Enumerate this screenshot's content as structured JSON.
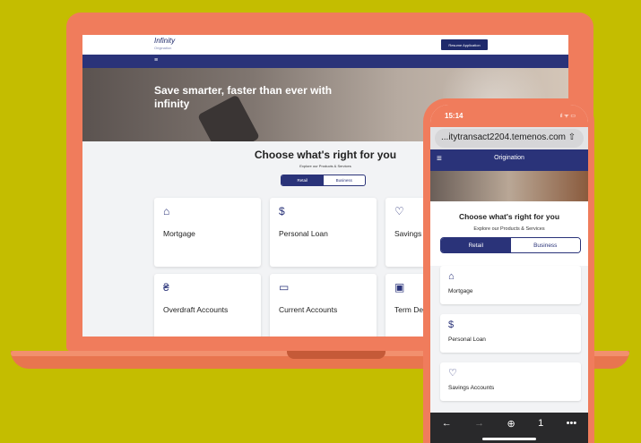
{
  "laptop": {
    "logo": "Infinity",
    "logo_sub": "Origination",
    "resume_button": "Resume Application",
    "menu_icon": "≡",
    "hero_text": "Save smarter, faster than ever with infinity",
    "heading": "Choose what's right for you",
    "subheading": "Explore our Products & Services",
    "tabs": [
      "Retail",
      "Business"
    ],
    "cards": [
      {
        "label": "Mortgage",
        "icon": "house-icon",
        "glyph": "⌂"
      },
      {
        "label": "Personal Loan",
        "icon": "hand-dollar-icon",
        "glyph": "$"
      },
      {
        "label": "Savings",
        "icon": "piggy-bank-icon",
        "glyph": "♡"
      },
      {
        "label": "Overdraft Accounts",
        "icon": "money-bag-icon",
        "glyph": "₴"
      },
      {
        "label": "Current Accounts",
        "icon": "banknote-icon",
        "glyph": "▭"
      },
      {
        "label": "Term De",
        "icon": "safe-icon",
        "glyph": "▣"
      }
    ]
  },
  "phone": {
    "time": "15:14",
    "status_icons": "ıl ᯤ ▭",
    "url": "...itytransact2204.temenos.com ⇧",
    "menu_icon": "≡",
    "title": "Origination",
    "heading": "Choose what's right for you",
    "subheading": "Explore our Products & Services",
    "tabs": [
      "Retail",
      "Business"
    ],
    "cards": [
      {
        "label": "Mortgage",
        "icon": "house-icon",
        "glyph": "⌂"
      },
      {
        "label": "Personal Loan",
        "icon": "hand-dollar-icon",
        "glyph": "$"
      },
      {
        "label": "Savings Accounts",
        "icon": "piggy-bank-icon",
        "glyph": "♡"
      }
    ],
    "toolbar": [
      "←",
      "→",
      "⊕",
      "1",
      "•••"
    ]
  },
  "colors": {
    "background": "#c4bd00",
    "device": "#f07c5c",
    "brand": "#2a3379"
  }
}
